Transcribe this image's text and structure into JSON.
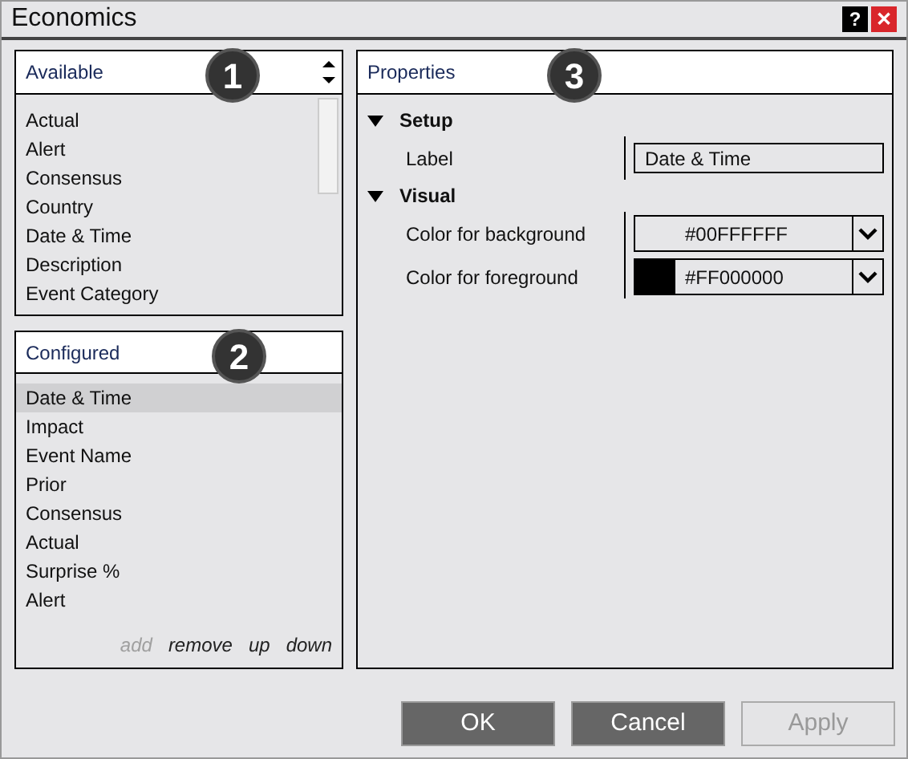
{
  "window": {
    "title": "Economics",
    "help": "?",
    "close": "✕"
  },
  "available": {
    "title": "Available",
    "badge": "1",
    "items": [
      "Actual",
      "Alert",
      "Consensus",
      "Country",
      "Date & Time",
      "Description",
      "Event Category"
    ]
  },
  "configured": {
    "title": "Configured",
    "badge": "2",
    "items": [
      {
        "label": "Date & Time",
        "selected": true
      },
      {
        "label": "Impact",
        "selected": false
      },
      {
        "label": "Event Name",
        "selected": false
      },
      {
        "label": "Prior",
        "selected": false
      },
      {
        "label": "Consensus",
        "selected": false
      },
      {
        "label": "Actual",
        "selected": false
      },
      {
        "label": "Surprise %",
        "selected": false
      },
      {
        "label": "Alert",
        "selected": false
      }
    ],
    "actions": [
      {
        "label": "add",
        "disabled": true
      },
      {
        "label": "remove",
        "disabled": false
      },
      {
        "label": "up",
        "disabled": false
      },
      {
        "label": "down",
        "disabled": false
      }
    ]
  },
  "properties": {
    "title": "Properties",
    "badge": "3",
    "sections": [
      {
        "name": "Setup",
        "expanded": true,
        "rows": [
          {
            "kind": "text",
            "label": "Label",
            "value": "Date & Time"
          }
        ]
      },
      {
        "name": "Visual",
        "expanded": true,
        "rows": [
          {
            "kind": "color",
            "label": "Color for background",
            "value": "#00FFFFFF"
          },
          {
            "kind": "color",
            "label": "Color for foreground",
            "value": "#FF000000",
            "color": "#000000"
          }
        ]
      }
    ]
  },
  "buttons": [
    {
      "label": "OK",
      "disabled": false
    },
    {
      "label": "Cancel",
      "disabled": false
    },
    {
      "label": "Apply",
      "disabled": true
    }
  ]
}
